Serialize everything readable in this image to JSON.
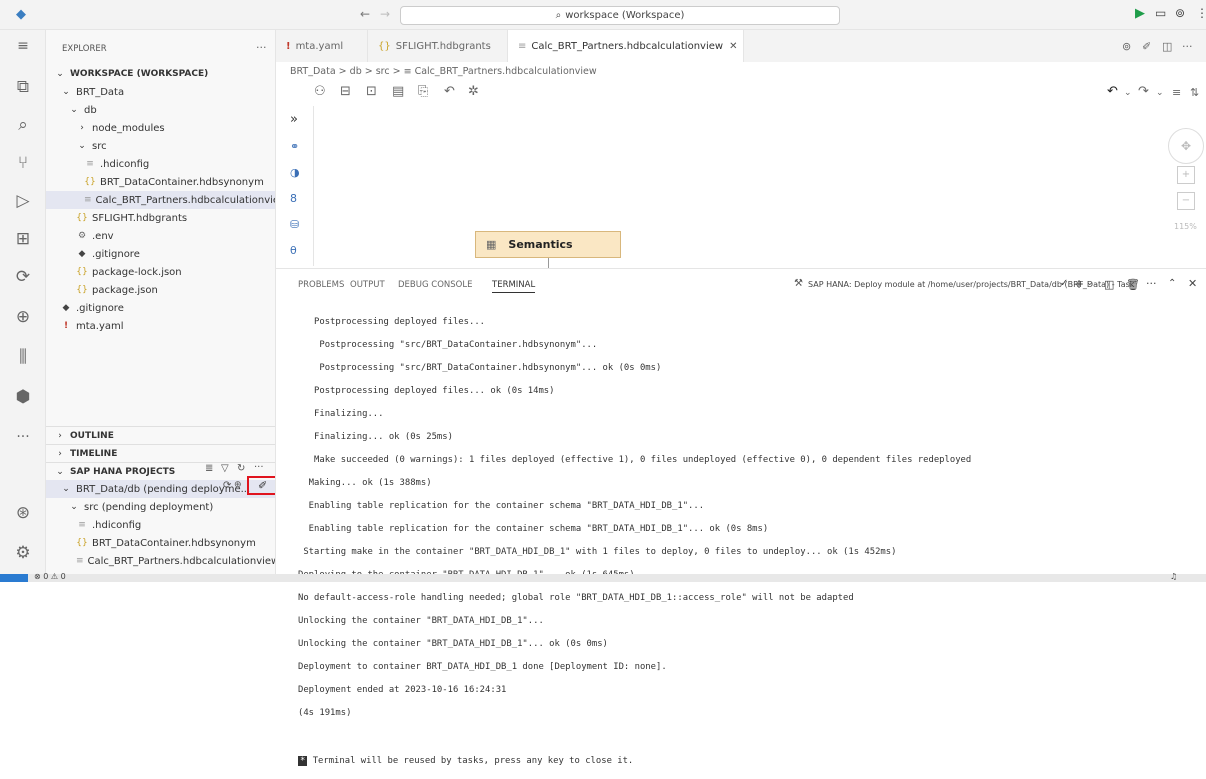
{
  "titlebar": {
    "search": "workspace (Workspace)"
  },
  "sidebar": {
    "explorer": "EXPLORER",
    "workspace": "WORKSPACE (WORKSPACE)",
    "tree": [
      "BRT_Data",
      "db",
      "node_modules",
      "src",
      ".hdiconfig",
      "BRT_DataContainer.hdbsynonym",
      "Calc_BRT_Partners.hdbcalculationview",
      "SFLIGHT.hdbgrants",
      ".env",
      ".gitignore",
      "package-lock.json",
      "package.json",
      ".gitignore",
      "mta.yaml"
    ],
    "outline": "OUTLINE",
    "timeline": "TIMELINE",
    "hana": "SAP HANA PROJECTS",
    "hana_items": [
      "BRT_Data/db (pending deployme...",
      "src (pending deployment)",
      ".hdiconfig",
      "BRT_DataContainer.hdbsynonym",
      "Calc_BRT_Partners.hdbcalculationview"
    ]
  },
  "tabs": [
    "mta.yaml",
    "SFLIGHT.hdbgrants",
    "Calc_BRT_Partners.hdbcalculationview"
  ],
  "breadcrumb": "BRT_Data > db > src > ≡ Calc_BRT_Partners.hdbcalculationview",
  "editor": {
    "semantics": "Semantics",
    "zoom": "115%"
  },
  "panel": {
    "tabs": [
      "PROBLEMS",
      "OUTPUT",
      "DEBUG CONSOLE",
      "TERMINAL"
    ],
    "task": "SAP HANA: Deploy module at /home/user/projects/BRT_Data/db (BRT_Data) - Task",
    "lines": [
      "   Postprocessing deployed files...",
      "    Postprocessing \"src/BRT_DataContainer.hdbsynonym\"...",
      "    Postprocessing \"src/BRT_DataContainer.hdbsynonym\"... ok (0s 0ms)",
      "   Postprocessing deployed files... ok (0s 14ms)",
      "   Finalizing...",
      "   Finalizing... ok (0s 25ms)",
      "   Make succeeded (0 warnings): 1 files deployed (effective 1), 0 files undeployed (effective 0), 0 dependent files redeployed",
      "  Making... ok (1s 388ms)",
      "  Enabling table replication for the container schema \"BRT_DATA_HDI_DB_1\"...",
      "  Enabling table replication for the container schema \"BRT_DATA_HDI_DB_1\"... ok (0s 8ms)",
      " Starting make in the container \"BRT_DATA_HDI_DB_1\" with 1 files to deploy, 0 files to undeploy... ok (1s 452ms)",
      "Deploying to the container \"BRT_DATA_HDI_DB_1\"... ok (1s 645ms)",
      "No default-access-role handling needed; global role \"BRT_DATA_HDI_DB_1::access_role\" will not be adapted",
      "Unlocking the container \"BRT_DATA_HDI_DB_1\"...",
      "Unlocking the container \"BRT_DATA_HDI_DB_1\"... ok (0s 0ms)",
      "Deployment to container BRT_DATA_HDI_DB_1 done [Deployment ID: none].",
      "Deployment ended at 2023-10-16 16:24:31",
      "(4s 191ms)"
    ],
    "reuse": "Terminal will be reused by tasks, press any key to close it."
  },
  "status": {
    "errors": "⊗ 0 ⚠ 0"
  }
}
